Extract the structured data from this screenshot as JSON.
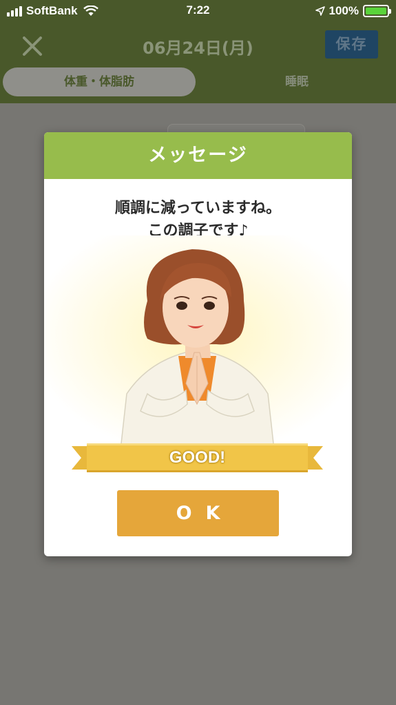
{
  "status_bar": {
    "carrier": "SoftBank",
    "time": "7:22",
    "battery_percent": "100%",
    "battery_level": 1.0
  },
  "header": {
    "close_icon": "close-icon",
    "date_title": "06月24日(月)",
    "save_label": "保存",
    "tabs": [
      {
        "label": "体重・体脂肪",
        "active": true
      },
      {
        "label": "睡眠",
        "active": false
      }
    ]
  },
  "dialog": {
    "title": "メッセージ",
    "message_line1": "順調に減っていますね。",
    "message_line2": "この調子です♪",
    "badge": "GOOD!",
    "ok_label": "OK"
  },
  "colors": {
    "header_bg": "#49582a",
    "dialog_title_bg": "#97bc4c",
    "ok_button": "#e5a63a",
    "save_button": "#1f4563",
    "overlay": "#777672"
  }
}
